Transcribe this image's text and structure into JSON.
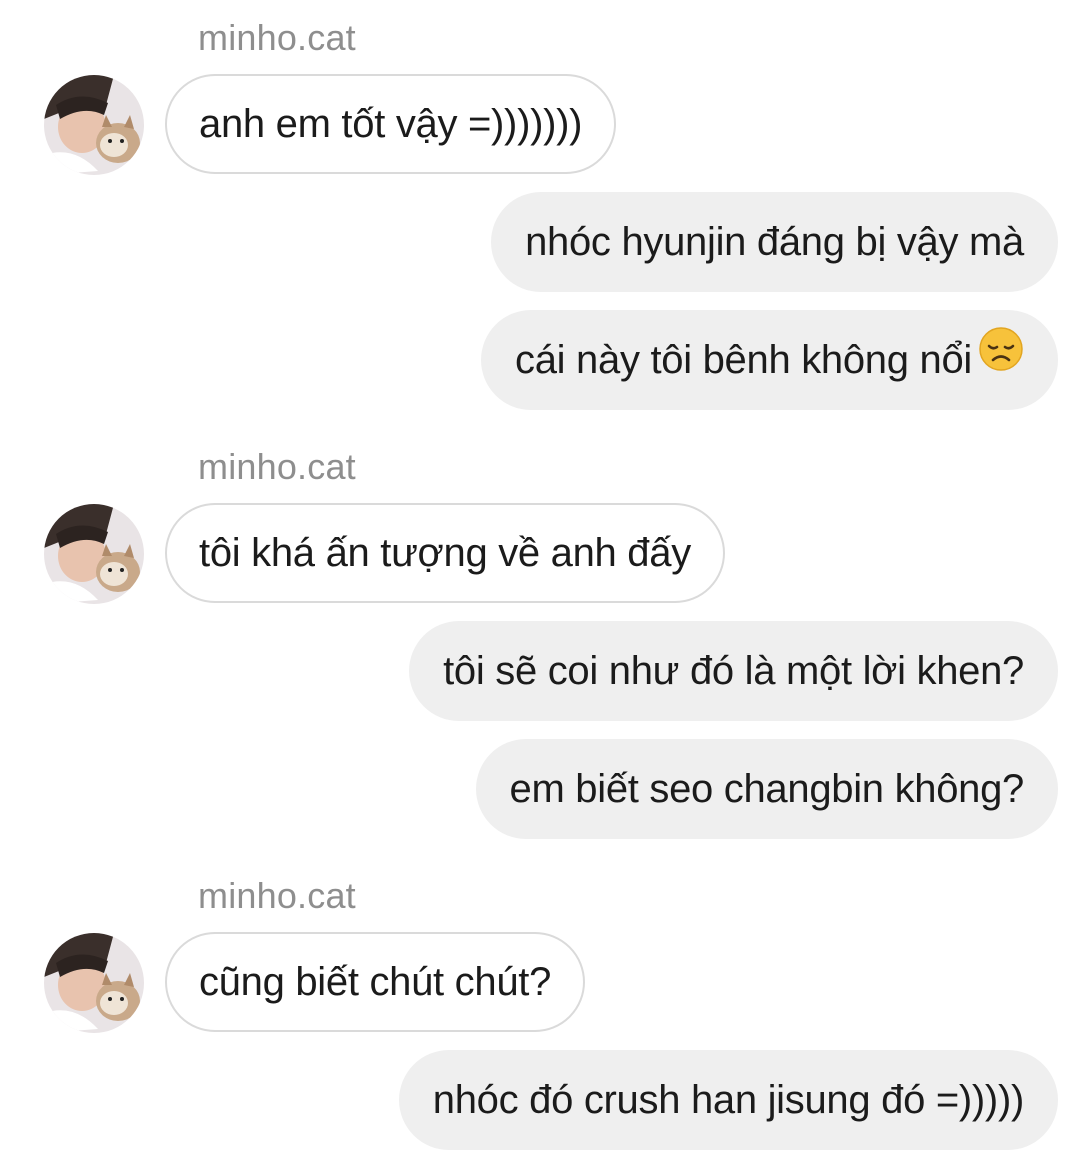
{
  "conversation": {
    "messages": [
      {
        "sender": "minho.cat",
        "text": "anh em tốt vậy =)))))))"
      },
      {
        "text": "nhóc hyunjin đáng bị vậy mà"
      },
      {
        "text": "cái này tôi bênh không nổi",
        "emoji": "disappointed-face-icon"
      },
      {
        "sender": "minho.cat",
        "text": "tôi khá ấn tượng về anh đấy"
      },
      {
        "text": "tôi sẽ coi như đó là một lời khen?"
      },
      {
        "text": "em biết seo changbin không?"
      },
      {
        "sender": "minho.cat",
        "text": "cũng biết chút chút?"
      },
      {
        "text": "nhóc đó crush han jisung đó =)))))"
      }
    ]
  }
}
